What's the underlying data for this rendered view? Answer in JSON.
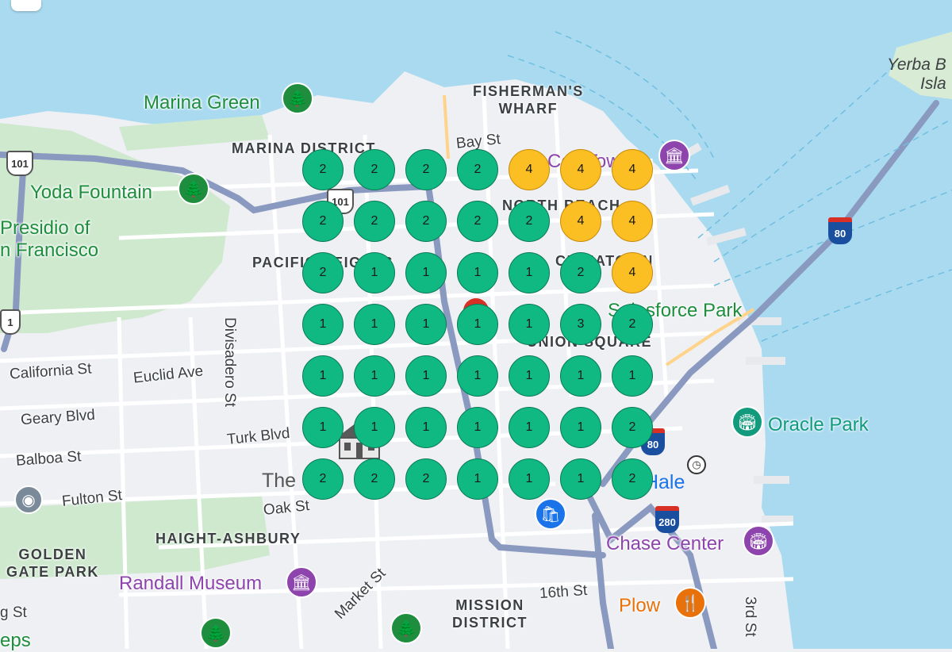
{
  "map": {
    "streets": [
      {
        "id": "bay-st",
        "text": "Bay St"
      },
      {
        "id": "divisadero-st",
        "text": "Divisadero St"
      },
      {
        "id": "california-st",
        "text": "California St"
      },
      {
        "id": "euclid-ave",
        "text": "Euclid Ave"
      },
      {
        "id": "geary-blvd",
        "text": "Geary Blvd"
      },
      {
        "id": "turk-blvd",
        "text": "Turk Blvd"
      },
      {
        "id": "balboa-st",
        "text": "Balboa St"
      },
      {
        "id": "fulton-st",
        "text": "Fulton St"
      },
      {
        "id": "oak-st",
        "text": "Oak St"
      },
      {
        "id": "market-st",
        "text": "Market St"
      },
      {
        "id": "16th-st",
        "text": "16th St"
      },
      {
        "id": "3rd-st",
        "text": "3rd St"
      },
      {
        "id": "g-st",
        "text": "g St"
      }
    ],
    "districts": {
      "fishermans_wharf": "FISHERMAN'S\nWHARF",
      "marina": "MARINA DISTRICT",
      "north_beach": "NORTH BEACH",
      "pacific_heights": "PACIFIC HEIGHTS",
      "chinatown": "CHINATOWN",
      "union_square": "UNION SQUARE",
      "haight": "HAIGHT-ASHBURY",
      "golden_gate_park": "GOLDEN\nGATE PARK",
      "mission": "MISSION\nDISTRICT"
    },
    "parks": {
      "marina_green": "Marina Green",
      "yoda_fountain": "Yoda Fountain",
      "presidio": "Presidio of\nn Francisco",
      "salesforce_park": "Salesforce Park"
    },
    "pois": {
      "coit_tower": "Coit Tower",
      "oracle_park": "Oracle Park",
      "chase_center": "Chase Center",
      "randall_museum": "Randall Museum",
      "plow": "Plow",
      "yerba_buena": "Yerba B\nIsla",
      "the_painted_ladies": "The",
      "city_hall": "ity Hale",
      "steps": "eps"
    },
    "shields": {
      "us101_a": "101",
      "us101_b": "101",
      "i80": "80",
      "i280": "280",
      "i80_b": "80",
      "route_1": "1"
    }
  },
  "grid": {
    "rows": [
      [
        2,
        2,
        2,
        2,
        4,
        4,
        4
      ],
      [
        2,
        2,
        2,
        2,
        2,
        4,
        4
      ],
      [
        2,
        1,
        1,
        1,
        1,
        2,
        4
      ],
      [
        1,
        1,
        1,
        1,
        1,
        3,
        2
      ],
      [
        1,
        1,
        1,
        1,
        1,
        1,
        1
      ],
      [
        1,
        1,
        1,
        1,
        1,
        1,
        2
      ],
      [
        2,
        2,
        2,
        1,
        1,
        1,
        2
      ]
    ],
    "colors": {
      "low": "#10b981",
      "high": "#fbbf24"
    }
  }
}
